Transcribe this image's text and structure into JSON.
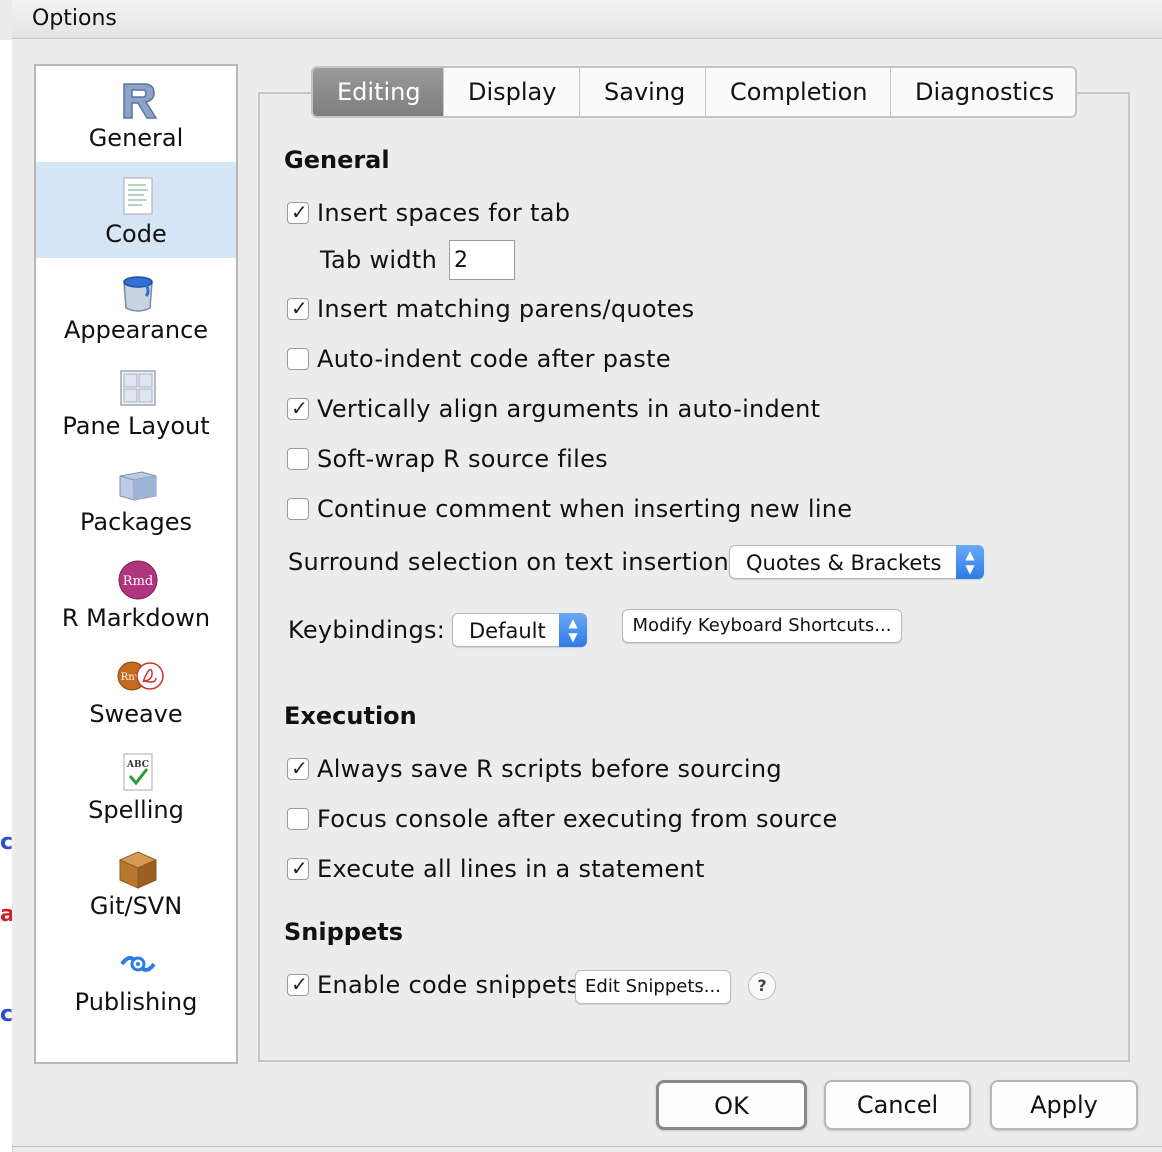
{
  "window": {
    "title": "Options"
  },
  "sidebar": {
    "items": [
      {
        "label": "General",
        "icon": "r-logo-icon",
        "selected": false
      },
      {
        "label": "Code",
        "icon": "code-document-icon",
        "selected": true
      },
      {
        "label": "Appearance",
        "icon": "paint-bucket-icon",
        "selected": false
      },
      {
        "label": "Pane Layout",
        "icon": "pane-grid-icon",
        "selected": false
      },
      {
        "label": "Packages",
        "icon": "package-cube-icon",
        "selected": false
      },
      {
        "label": "R Markdown",
        "icon": "rmarkdown-icon",
        "selected": false
      },
      {
        "label": "Sweave",
        "icon": "sweave-pdf-icon",
        "selected": false
      },
      {
        "label": "Spelling",
        "icon": "spellcheck-icon",
        "selected": false
      },
      {
        "label": "Git/SVN",
        "icon": "git-box-icon",
        "selected": false
      },
      {
        "label": "Publishing",
        "icon": "publishing-icon",
        "selected": false
      }
    ]
  },
  "tabs": [
    {
      "label": "Editing",
      "active": true
    },
    {
      "label": "Display",
      "active": false
    },
    {
      "label": "Saving",
      "active": false
    },
    {
      "label": "Completion",
      "active": false
    },
    {
      "label": "Diagnostics",
      "active": false
    }
  ],
  "general": {
    "heading": "General",
    "insert_spaces": {
      "label": "Insert spaces for tab",
      "checked": true
    },
    "tab_width": {
      "label": "Tab width",
      "value": "2"
    },
    "matching_parens": {
      "label": "Insert matching parens/quotes",
      "checked": true
    },
    "auto_indent_paste": {
      "label": "Auto-indent code after paste",
      "checked": false
    },
    "vertical_align": {
      "label": "Vertically align arguments in auto-indent",
      "checked": true
    },
    "soft_wrap": {
      "label": "Soft-wrap R source files",
      "checked": false
    },
    "continue_comment": {
      "label": "Continue comment when inserting new line",
      "checked": false
    },
    "surround": {
      "label": "Surround selection on text insertion:",
      "value": "Quotes & Brackets"
    },
    "keybindings": {
      "label": "Keybindings:",
      "value": "Default",
      "modify_button": "Modify Keyboard Shortcuts..."
    }
  },
  "execution": {
    "heading": "Execution",
    "always_save": {
      "label": "Always save R scripts before sourcing",
      "checked": true
    },
    "focus_console": {
      "label": "Focus console after executing from source",
      "checked": false
    },
    "execute_all": {
      "label": "Execute all lines in a statement",
      "checked": true
    }
  },
  "snippets": {
    "heading": "Snippets",
    "enable": {
      "label": "Enable code snippets",
      "checked": true
    },
    "edit_button": "Edit Snippets...",
    "help": "?"
  },
  "buttons": {
    "ok": "OK",
    "cancel": "Cancel",
    "apply": "Apply"
  },
  "colors": {
    "tab_active": "#8a8a8a",
    "sidebar_selected": "#d6e5f5",
    "select_arrow": "#3a86ec"
  }
}
